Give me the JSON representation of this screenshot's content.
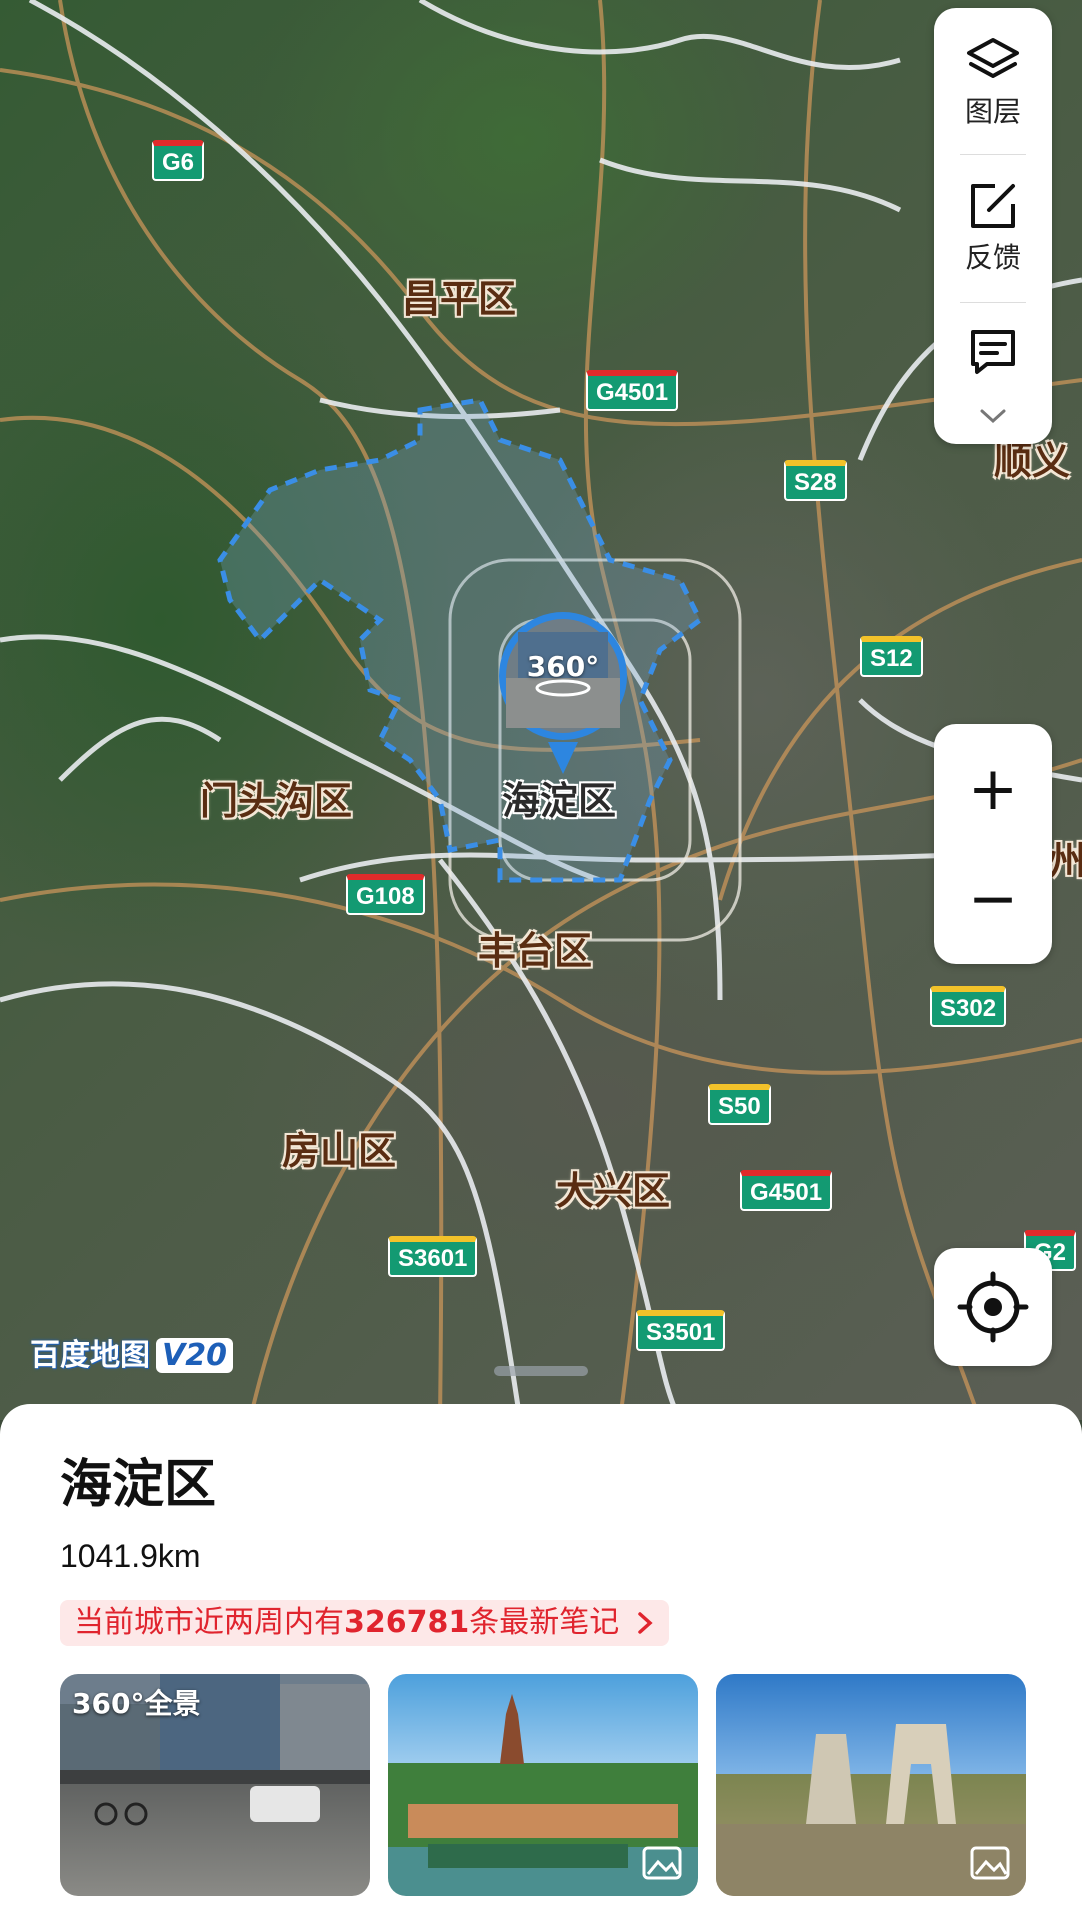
{
  "map": {
    "districts": {
      "changping": "昌平区",
      "mentougou": "门头沟区",
      "haidian": "海淀区",
      "fengtai": "丰台区",
      "fangshan": "房山区",
      "daxing": "大兴区",
      "shunyi_partial": "顺义",
      "tongzhou_partial": "州"
    },
    "road_shields": [
      "G6",
      "G4501",
      "S28",
      "S12",
      "G108",
      "S302",
      "S50",
      "G4501",
      "S3601",
      "S3501",
      "G2"
    ],
    "panorama_label": "360°",
    "logo": "百度地图",
    "logo_version": "V20",
    "colors": {
      "boundary": "#3a8ee6",
      "expressway": "#139a72"
    }
  },
  "toolbar": {
    "layers_label": "图层",
    "feedback_label": "反馈"
  },
  "zoom": {
    "in_label": "+",
    "out_label": "−"
  },
  "sheet": {
    "title": "海淀区",
    "distance": "1041.9km",
    "note_prefix": "当前城市近两周内有",
    "note_count": "326781",
    "note_suffix": "条最新笔记",
    "photos": [
      {
        "badge": "360°全景",
        "icon": "panorama-icon"
      },
      {
        "badge": "",
        "icon": "image-icon"
      },
      {
        "badge": "",
        "icon": "image-icon"
      }
    ]
  }
}
